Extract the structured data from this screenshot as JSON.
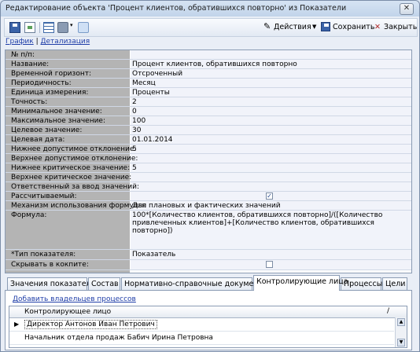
{
  "window": {
    "title": "Редактирование объекта 'Процент клиентов, обратившихся повторно' из Показатели",
    "close_label": "✕"
  },
  "toolbar": {
    "actions_label": "Действия",
    "save_label": "Сохранить",
    "close_label": "Закрыть"
  },
  "links": {
    "chart": "График",
    "detail": "Детализация"
  },
  "properties": [
    {
      "label": "№ п/п:",
      "value": ""
    },
    {
      "label": "Название:",
      "value": "Процент клиентов, обратившихся повторно"
    },
    {
      "label": "Временной горизонт:",
      "value": "Отсроченный"
    },
    {
      "label": "Периодичность:",
      "value": "Месяц"
    },
    {
      "label": "Единица измерения:",
      "value": "Проценты"
    },
    {
      "label": "Точность:",
      "value": "2"
    },
    {
      "label": "Минимальное значение:",
      "value": "0"
    },
    {
      "label": "Максимальное значение:",
      "value": "100"
    },
    {
      "label": "Целевое значение:",
      "value": "30"
    },
    {
      "label": "Целевая дата:",
      "value": "01.01.2014"
    },
    {
      "label": "Нижнее допустимое отклонение:",
      "value": "5"
    },
    {
      "label": "Верхнее допустимое отклонение:",
      "value": ""
    },
    {
      "label": "Нижнее критическое значение:",
      "value": "5"
    },
    {
      "label": "Верхнее критическое значение:",
      "value": ""
    },
    {
      "label": "Ответственный за ввод значений:",
      "value": ""
    },
    {
      "label": "Рассчитываемый:",
      "value": "",
      "checked": true
    },
    {
      "label": "Механизм использования формулы:",
      "value": "Для плановых и фактических значений"
    },
    {
      "label": "Формула:",
      "value": "100*[Количество клиентов, обратившихся повторно]/([Количество привлеченных клиентов]+[Количество клиентов, обратившихся повторно])"
    },
    {
      "label": "*Тип показателя:",
      "value": "Показатель"
    },
    {
      "label": "Скрывать в кокпите:",
      "value": "",
      "checked": false
    }
  ],
  "tabs": [
    {
      "label": "Значения показателя"
    },
    {
      "label": "Состав"
    },
    {
      "label": "Нормативно-справочные документы"
    },
    {
      "label": "Контролирующие лица",
      "active": true
    },
    {
      "label": "Процессы"
    },
    {
      "label": "Цели"
    }
  ],
  "owners_panel": {
    "add_link": "Добавить владельцев процессов",
    "column_header": "Контролирующее лицо",
    "sort_indicator": "/",
    "rows": [
      {
        "name": "Директор Антонов Иван Петрович",
        "current": true
      },
      {
        "name": "Начальник отдела продаж Бабич Ирина Петровна",
        "current": false
      }
    ]
  }
}
